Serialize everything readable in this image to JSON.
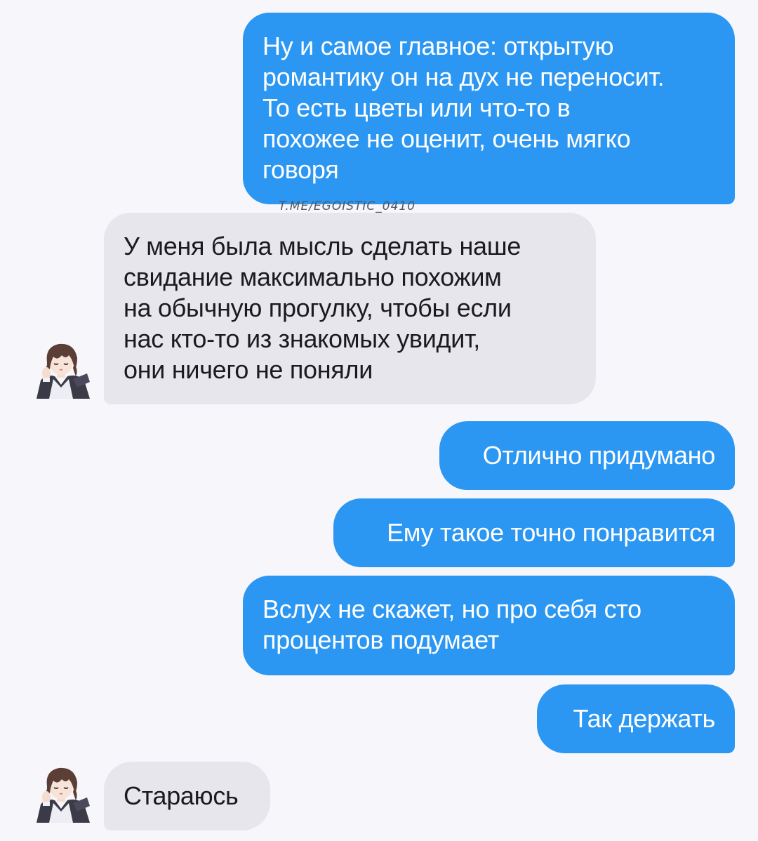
{
  "watermark": "T.ME/EGOISTIC_0410",
  "messages": [
    {
      "direction": "outgoing",
      "lines": [
        "Ну и самое главное: открытую",
        "романтику он на дух не переносит.",
        "То есть цветы или что-то в",
        "похожее не оценит, очень мягко",
        "говоря"
      ]
    },
    {
      "direction": "incoming",
      "lines": [
        "У меня была мысль сделать наше",
        "свидание максимально похожим",
        "на обычную прогулку, чтобы если",
        "нас кто-то из знакомых увидит,",
        "они ничего не поняли"
      ]
    },
    {
      "direction": "outgoing",
      "lines": [
        "Отлично придумано"
      ]
    },
    {
      "direction": "outgoing",
      "lines": [
        "Ему такое точно понравится"
      ]
    },
    {
      "direction": "outgoing",
      "lines": [
        "Вслух не скажет, но про себя сто",
        "процентов подумает"
      ]
    },
    {
      "direction": "outgoing",
      "lines": [
        "Так держать"
      ]
    },
    {
      "direction": "incoming",
      "lines": [
        "Стараюсь"
      ]
    }
  ],
  "colors": {
    "background": "#f7f6fa",
    "outgoing_bubble": "#2b97f2",
    "incoming_bubble": "#e6e6ec",
    "outgoing_text": "#ffffff",
    "incoming_text": "#1b1b1f"
  },
  "icons": {
    "avatar": "anime-character-avatar-icon"
  }
}
